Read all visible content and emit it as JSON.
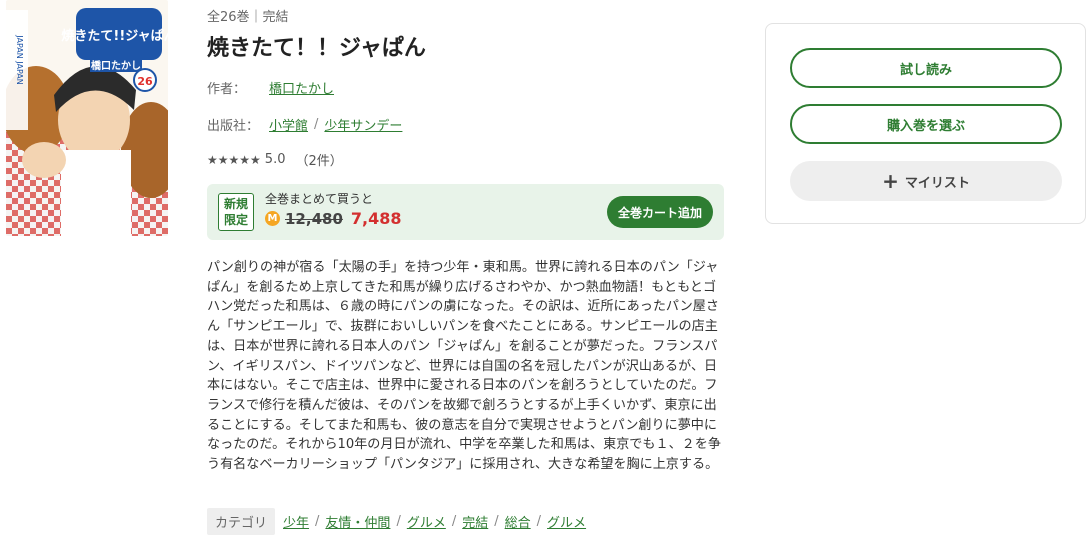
{
  "book": {
    "meta": "全26巻｜完結",
    "title": "焼きたて！！ジャぱん",
    "author_label": "作者：",
    "author": "橋口たかし",
    "publisher_label": "出版社：",
    "publisher": "小学館",
    "publisher_sep": "/",
    "label": "少年サンデー",
    "stars": "★★★★★",
    "rating": "5.0",
    "review_count": "（2件）"
  },
  "cover": {
    "badge_number": "26",
    "title_art": "焼きたて!!ジャぱん",
    "author_art": "橋口たかし"
  },
  "promo": {
    "badge_line1": "新規",
    "badge_line2": "限定",
    "text": "全巻まとめて買うと",
    "icon_text": "M",
    "old_price": "12,480",
    "new_price": "7,488",
    "cart_button": "全巻カート追加"
  },
  "description": "パン創りの神が宿る「太陽の手」を持つ少年・東和馬。世界に誇れる日本のパン「ジャぱん」を創るため上京してきた和馬が繰り広げるさわやか、かつ熱血物語！もともとゴハン党だった和馬は、６歳の時にパンの虜になった。その訳は、近所にあったパン屋さん「サンピエール」で、抜群においしいパンを食べたことにある。サンピエールの店主は、日本が世界に誇れる日本人のパン「ジャぱん」を創ることが夢だった。フランスパン、イギリスパン、ドイツパンなど、世界には自国の名を冠したパンが沢山あるが、日本にはない。そこで店主は、世界中に愛される日本のパンを創ろうとしていたのだ。フランスで修行を積んだ彼は、そのパンを故郷で創ろうとするが上手くいかず、東京に出ることにする。そしてまた和馬も、彼の意志を自分で実現させようとパン創りに夢中になったのだ。それから10年の月日が流れ、中学を卒業した和馬は、東京でも１、２を争う有名なベーカリーショップ「パンタジア」に採用され、大きな希望を胸に上京する。",
  "categories": {
    "label": "カテゴリ",
    "sep": "/",
    "items": [
      "少年",
      "友情・仲間",
      "グルメ",
      "完結",
      "総合",
      "グルメ"
    ]
  },
  "panel": {
    "trial_button": "試し読み",
    "select_button": "購入巻を選ぶ",
    "mylist_plus": "+",
    "mylist_button": "マイリスト"
  },
  "colors": {
    "accent": "#2e7d32",
    "price_red": "#d32f2f",
    "promo_bg": "#e8f3e9"
  }
}
